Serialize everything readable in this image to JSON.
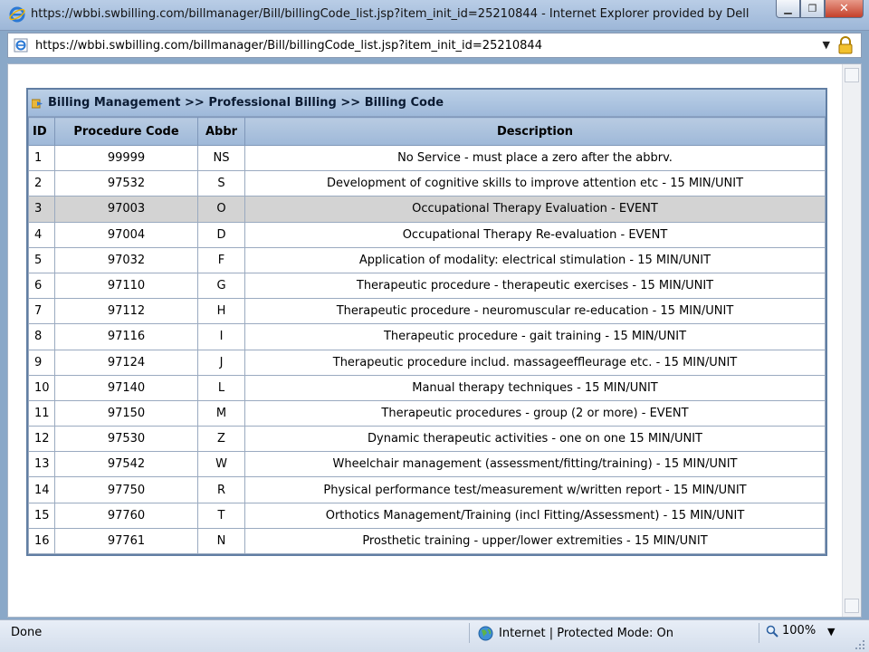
{
  "window": {
    "title": "https://wbbi.swbilling.com/billmanager/Bill/billingCode_list.jsp?item_init_id=25210844 - Internet Explorer provided by Dell",
    "minimize_label": "▁",
    "restore_label": "❐",
    "close_label": "✕"
  },
  "address_bar": {
    "url": "https://wbbi.swbilling.com/billmanager/Bill/billingCode_list.jsp?item_init_id=25210844",
    "dropdown_label": "▼"
  },
  "breadcrumb": {
    "text": "Billing Management >> Professional Billing >> Billing Code"
  },
  "table": {
    "columns": [
      "ID",
      "Procedure Code",
      "Abbr",
      "Description"
    ],
    "highlighted_row": 2,
    "rows": [
      {
        "id": "1",
        "code": "99999",
        "abbr": "NS",
        "description": "No Service - must place a zero after the abbrv."
      },
      {
        "id": "2",
        "code": "97532",
        "abbr": "S",
        "description": "Development of cognitive skills to improve attention etc - 15 MIN/UNIT"
      },
      {
        "id": "3",
        "code": "97003",
        "abbr": "O",
        "description": "Occupational Therapy Evaluation - EVENT"
      },
      {
        "id": "4",
        "code": "97004",
        "abbr": "D",
        "description": "Occupational Therapy Re-evaluation - EVENT"
      },
      {
        "id": "5",
        "code": "97032",
        "abbr": "F",
        "description": "Application of modality: electrical stimulation - 15 MIN/UNIT"
      },
      {
        "id": "6",
        "code": "97110",
        "abbr": "G",
        "description": "Therapeutic procedure - therapeutic exercises - 15 MIN/UNIT"
      },
      {
        "id": "7",
        "code": "97112",
        "abbr": "H",
        "description": "Therapeutic procedure - neuromuscular re-education - 15 MIN/UNIT"
      },
      {
        "id": "8",
        "code": "97116",
        "abbr": "I",
        "description": "Therapeutic procedure - gait training - 15 MIN/UNIT"
      },
      {
        "id": "9",
        "code": "97124",
        "abbr": "J",
        "description": "Therapeutic procedure includ. massageeffleurage etc. - 15 MIN/UNIT"
      },
      {
        "id": "10",
        "code": "97140",
        "abbr": "L",
        "description": "Manual therapy techniques - 15 MIN/UNIT"
      },
      {
        "id": "11",
        "code": "97150",
        "abbr": "M",
        "description": "Therapeutic procedures - group (2 or more) - EVENT"
      },
      {
        "id": "12",
        "code": "97530",
        "abbr": "Z",
        "description": "Dynamic therapeutic activities - one on one 15 MIN/UNIT"
      },
      {
        "id": "13",
        "code": "97542",
        "abbr": "W",
        "description": "Wheelchair management (assessment/fitting/training) - 15 MIN/UNIT"
      },
      {
        "id": "14",
        "code": "97750",
        "abbr": "R",
        "description": "Physical performance test/measurement w/written report - 15 MIN/UNIT"
      },
      {
        "id": "15",
        "code": "97760",
        "abbr": "T",
        "description": "Orthotics Management/Training (incl Fitting/Assessment) - 15 MIN/UNIT"
      },
      {
        "id": "16",
        "code": "97761",
        "abbr": "N",
        "description": "Prosthetic training - upper/lower extremities - 15 MIN/UNIT"
      }
    ]
  },
  "status_bar": {
    "status": "Done",
    "zone": "Internet | Protected Mode: On",
    "zoom": "100%",
    "zoom_arrow": "▼"
  },
  "colors": {
    "header_blue": "#9eb8d8",
    "highlight_row": "#d3d3d3",
    "grid_border": "#617ea3"
  }
}
